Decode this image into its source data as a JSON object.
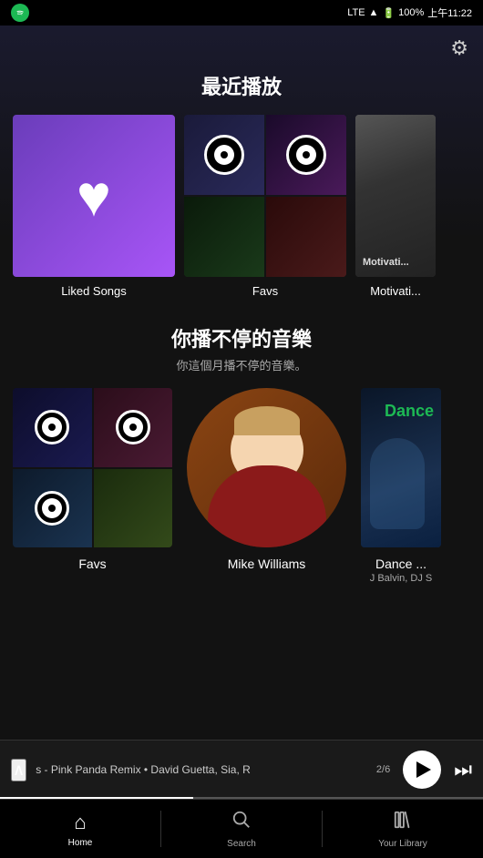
{
  "statusBar": {
    "network": "LTE",
    "time": "上午11:22",
    "battery": "100%"
  },
  "settings": {
    "icon": "⚙"
  },
  "recentlyPlayed": {
    "title": "最近播放",
    "items": [
      {
        "id": "liked-songs",
        "label": "Liked Songs",
        "type": "liked"
      },
      {
        "id": "favs",
        "label": "Favs",
        "type": "collage"
      },
      {
        "id": "motivati",
        "label": "Motivati...",
        "type": "gradient"
      }
    ]
  },
  "nonstop": {
    "title": "你播不停的音樂",
    "subtitle": "你這個月播不停的音樂。",
    "items": [
      {
        "id": "favs2",
        "label": "Favs",
        "sublabel": "",
        "type": "collage"
      },
      {
        "id": "mike-williams",
        "label": "Mike Williams",
        "sublabel": "",
        "type": "person"
      },
      {
        "id": "dance",
        "label": "Dance ...",
        "sublabel": "J Balvin, DJ S",
        "type": "dance"
      }
    ]
  },
  "nowPlaying": {
    "track": "s - Pink Panda Remix • David Guetta, Sia, R",
    "progress": "2/6"
  },
  "bottomNav": {
    "home": {
      "label": "Home",
      "icon": "🏠",
      "active": true
    },
    "search": {
      "label": "Search",
      "icon": "🔍",
      "active": false
    },
    "library": {
      "label": "Your Library",
      "icon": "📚",
      "active": false
    }
  }
}
